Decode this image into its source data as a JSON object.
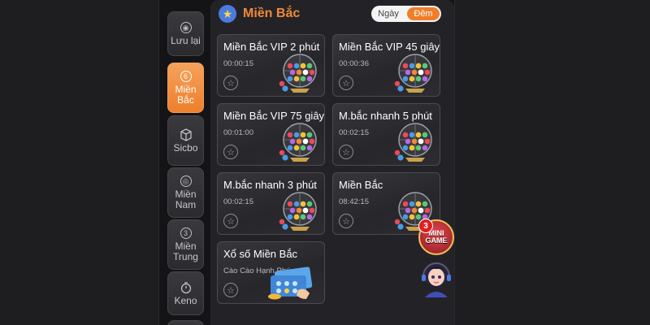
{
  "sidebar": {
    "items": [
      {
        "label": "Lưu lại",
        "icon": "save-ring-icon",
        "active": false
      },
      {
        "label": "Miền Bắc",
        "icon": "number-6-icon",
        "badge": "6",
        "active": true
      },
      {
        "label": "Sicbo",
        "icon": "dice-icon",
        "active": false
      },
      {
        "label": "Miền Nam",
        "icon": "ring-icon",
        "active": false
      },
      {
        "label": "Miền Trung",
        "icon": "number-3-icon",
        "badge": "3",
        "active": false
      },
      {
        "label": "Keno",
        "icon": "stopwatch-icon",
        "active": false
      }
    ]
  },
  "header": {
    "title": "Miền Bắc",
    "icon": "star-icon",
    "toggle": {
      "day": "Ngày",
      "night": "Đêm",
      "selected": "Đêm"
    }
  },
  "games": [
    {
      "title": "Miền Bắc VIP 2 phút",
      "time": "00:00:15",
      "art": "lottery-cage-icon"
    },
    {
      "title": "Miền Bắc VIP 45 giây",
      "time": "00:00:36",
      "art": "lottery-cage-icon"
    },
    {
      "title": "Miền Bắc VIP 75 giây",
      "time": "00:01:00",
      "art": "lottery-cage-icon"
    },
    {
      "title": "M.bắc nhanh 5 phút",
      "time": "00:02:15",
      "art": "lottery-cage-icon"
    },
    {
      "title": "M.bắc nhanh 3 phút",
      "time": "00:02:15",
      "art": "lottery-cage-icon"
    },
    {
      "title": "Miền Bắc",
      "time": "08:42:15",
      "art": "lottery-cage-icon"
    },
    {
      "title": "Xổ số Miền Bắc",
      "subtitle": "Cào Cào Hạnh Phúc",
      "art": "scratch-tickets-icon"
    }
  ],
  "floating": {
    "minigame": {
      "label_line1": "MINI",
      "label_line2": "GAME",
      "badge": "3"
    },
    "assistant": {
      "icon": "support-agent-avatar-icon"
    }
  },
  "colors": {
    "accent": "#f07d2a",
    "background": "#1e1e20",
    "panel": "#232327",
    "card": "#2d2d31"
  }
}
